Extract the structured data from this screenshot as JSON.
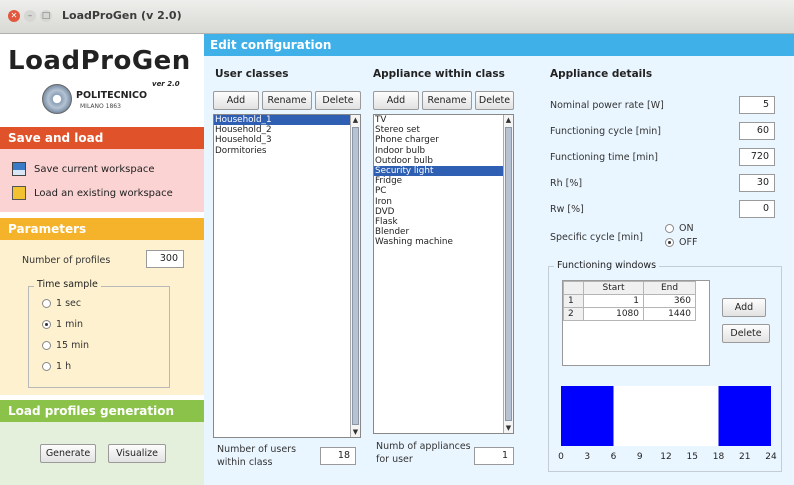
{
  "window": {
    "title": "LoadProGen (v 2.0)"
  },
  "logo": {
    "text": "LoadProGen",
    "version": "ver 2.0",
    "org": "POLITECNICO",
    "org_sub": "MILANO 1863"
  },
  "save_load": {
    "title": "Save and load",
    "save_label": "Save current workspace",
    "load_label": "Load an existing workspace"
  },
  "parameters": {
    "title": "Parameters",
    "profiles_label": "Number of profiles",
    "profiles_value": "300",
    "time_sample_label": "Time sample",
    "options": [
      "1 sec",
      "1 min",
      "15 min",
      "1 h"
    ],
    "selected": "1 min"
  },
  "generation": {
    "title": "Load profiles generation",
    "generate_label": "Generate",
    "visualize_label": "Visualize"
  },
  "edit": {
    "title": "Edit configuration",
    "user_classes": {
      "title": "User classes",
      "add": "Add",
      "rename": "Rename",
      "delete": "Delete",
      "items": [
        "Household_1",
        "Household_2",
        "Household_3",
        "Dormitories"
      ],
      "selected": "Household_1",
      "count_label_1": "Number of users",
      "count_label_2": "within class",
      "count_value": "18"
    },
    "appliances": {
      "title": "Appliance within class",
      "add": "Add",
      "rename": "Rename",
      "delete": "Delete",
      "items": [
        "TV",
        "Stereo set",
        "Phone charger",
        "Indoor bulb",
        "Outdoor bulb",
        "Security light",
        "Fridge",
        "PC",
        "Iron",
        "DVD",
        "Flask",
        "Blender",
        "Washing machine"
      ],
      "selected": "Security light",
      "count_label_1": "Numb of appliances",
      "count_label_2": "for user",
      "count_value": "1"
    },
    "details": {
      "title": "Appliance details",
      "fields": [
        {
          "label": "Nominal power rate [W]",
          "value": "5"
        },
        {
          "label": "Functioning cycle [min]",
          "value": "60"
        },
        {
          "label": "Functioning time [min]",
          "value": "720"
        },
        {
          "label": "Rh [%]",
          "value": "30"
        },
        {
          "label": "Rw [%]",
          "value": "0"
        }
      ],
      "specific_cycle_label": "Specific cycle [min]",
      "on_label": "ON",
      "off_label": "OFF",
      "specific_cycle_selected": "OFF",
      "windows_title": "Functioning windows",
      "table_headers": [
        "Start",
        "End"
      ],
      "table_rows": [
        {
          "idx": "1",
          "start": "1",
          "end": "360"
        },
        {
          "idx": "2",
          "start": "1080",
          "end": "1440"
        }
      ],
      "add": "Add",
      "delete": "Delete"
    }
  },
  "chart_data": {
    "type": "bar",
    "x_ticks": [
      "0",
      "3",
      "6",
      "9",
      "12",
      "15",
      "18",
      "21",
      "24"
    ],
    "xlim": [
      0,
      24
    ],
    "intervals_hours": [
      [
        0,
        6
      ],
      [
        18,
        24
      ]
    ],
    "bar_color": "#0000ff"
  }
}
